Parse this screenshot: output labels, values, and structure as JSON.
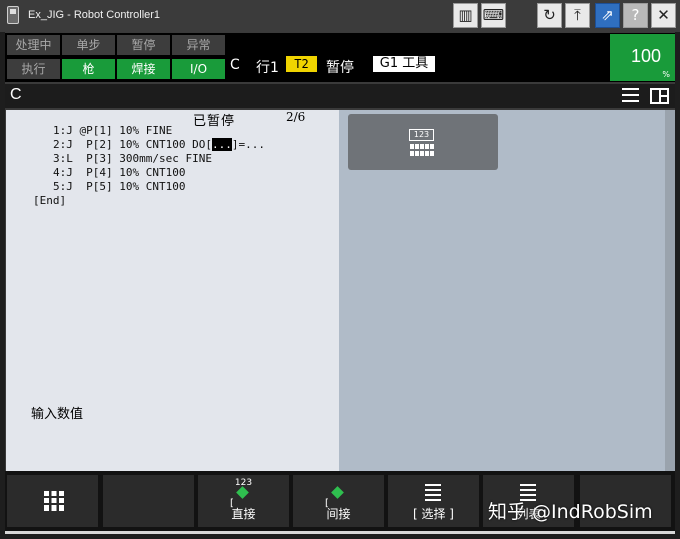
{
  "window": {
    "title": "Ex_JIG - Robot Controller1"
  },
  "status": {
    "row1": [
      "处理中",
      "单步",
      "暂停",
      "异常"
    ],
    "row2": [
      "执行",
      "枪",
      "焊接",
      "I/O"
    ],
    "mode": "C",
    "line": "行1",
    "tool_frame": "T2",
    "state": "暂停",
    "group_tool": "G1 工具",
    "override_value": "100",
    "override_unit": "%",
    "colors": {
      "led_on": "#199b3a",
      "t2_badge": "#f0d400"
    }
  },
  "menubar": {
    "breadcrumb": "C"
  },
  "program": {
    "header_label": "已暂停",
    "header_count": "2/6",
    "lines": [
      {
        "pre": "1:J @P[1] 10% FINE",
        "hl": "",
        "post": ""
      },
      {
        "pre": "2:J  P[2] 10% CNT100 DO[",
        "hl": "...",
        "post": "]=..."
      },
      {
        "pre": "3:L  P[3] 300mm/sec FINE",
        "hl": "",
        "post": ""
      },
      {
        "pre": "4:J  P[4] 10% CNT100",
        "hl": "",
        "post": ""
      },
      {
        "pre": "5:J  P[5] 10% CNT100",
        "hl": "",
        "post": ""
      },
      {
        "pre": "[End]",
        "hl": "",
        "post": ""
      }
    ],
    "prompt": "输入数值"
  },
  "keypad": {
    "label": "123"
  },
  "function_keys": [
    {
      "label": "",
      "icon": "grid-icon"
    },
    {
      "label": "",
      "icon": ""
    },
    {
      "label": "直接",
      "icon_text": "123",
      "icon": "edit-icon"
    },
    {
      "label": "间接",
      "icon": "edit-indirect-icon"
    },
    {
      "label": "[ 选择 ]",
      "icon": "list-icon"
    },
    {
      "label": "列表",
      "icon": "list-icon"
    },
    {
      "label": "",
      "icon": ""
    }
  ],
  "watermark": "知乎 @IndRobSim"
}
